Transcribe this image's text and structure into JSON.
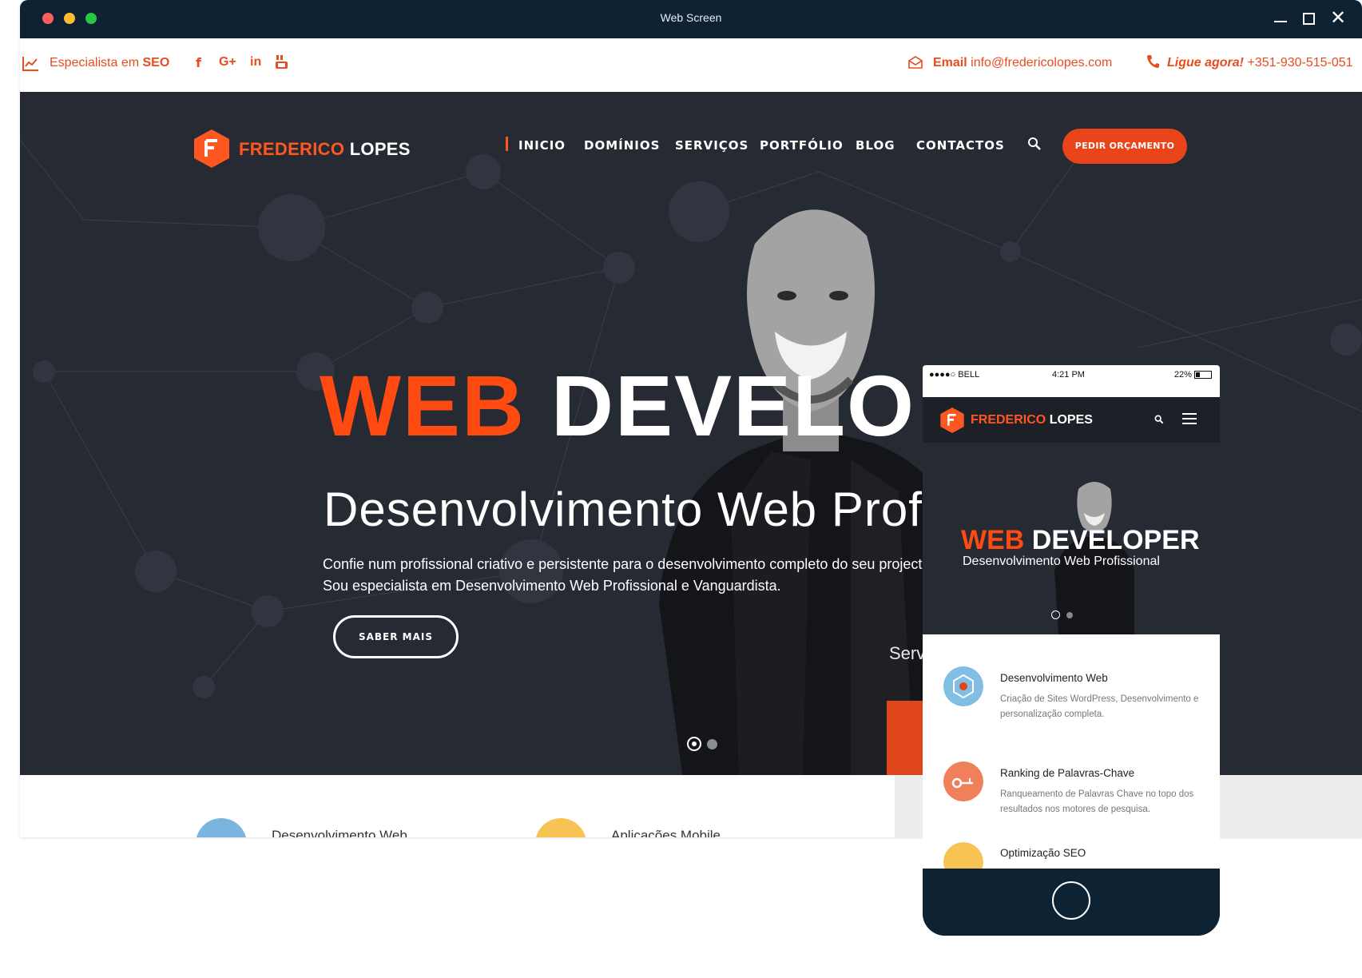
{
  "window": {
    "title": "Web Screen"
  },
  "topbar": {
    "tagline_pre": "Especialista em ",
    "tagline_bold": "SEO",
    "social": {
      "facebook": "f",
      "googleplus": "G+",
      "linkedin": "in"
    },
    "email_label": "Email",
    "email_value": "info@fredericolopes.com",
    "phone_label": "Ligue agora!",
    "phone_value": "+351-930-515-051"
  },
  "brand": {
    "first": "FREDERICO",
    "last": "LOPES"
  },
  "nav": {
    "items": [
      "INICIO",
      "DOMÍNIOS",
      "SERVIÇOS",
      "PORTFÓLIO",
      "BLOG",
      "CONTACTOS"
    ],
    "cta": "PEDIR ORÇAMENTO"
  },
  "hero": {
    "title_orange": "WEB",
    "title_white": "DEVELO",
    "subtitle": "Desenvolvimento Web Profis",
    "description": "Confie num profissional criativo e persistente para o desenvolvimento completo do seu projecto. Sou especialista em Desenvolvimento Web Profissional e Vanguardista.",
    "button": "SABER MAIS",
    "side_text": "Serviço"
  },
  "features": {
    "items": [
      "Desenvolvimento Web",
      "Aplicações Mobile"
    ]
  },
  "phone": {
    "status": {
      "carrier": "●●●●○ BELL",
      "time": "4:21 PM",
      "battery": "22%"
    },
    "hero_title_orange": "WEB",
    "hero_title_white": "DEVELOPER",
    "hero_subtitle": "Desenvolvimento Web Profissional",
    "services": [
      {
        "title": "Desenvolvimento Web",
        "desc": "Criação de Sites WordPress, Desenvolvimento e personalização completa."
      },
      {
        "title": "Ranking de Palavras-Chave",
        "desc": "Ranqueamento de Palavras Chave no topo dos resultados nos motores de pesquisa."
      },
      {
        "title": "Optimização SEO",
        "desc": ""
      }
    ]
  },
  "colors": {
    "accent": "#ea441a",
    "dark": "#262a33",
    "titlebar": "#0e2233"
  }
}
